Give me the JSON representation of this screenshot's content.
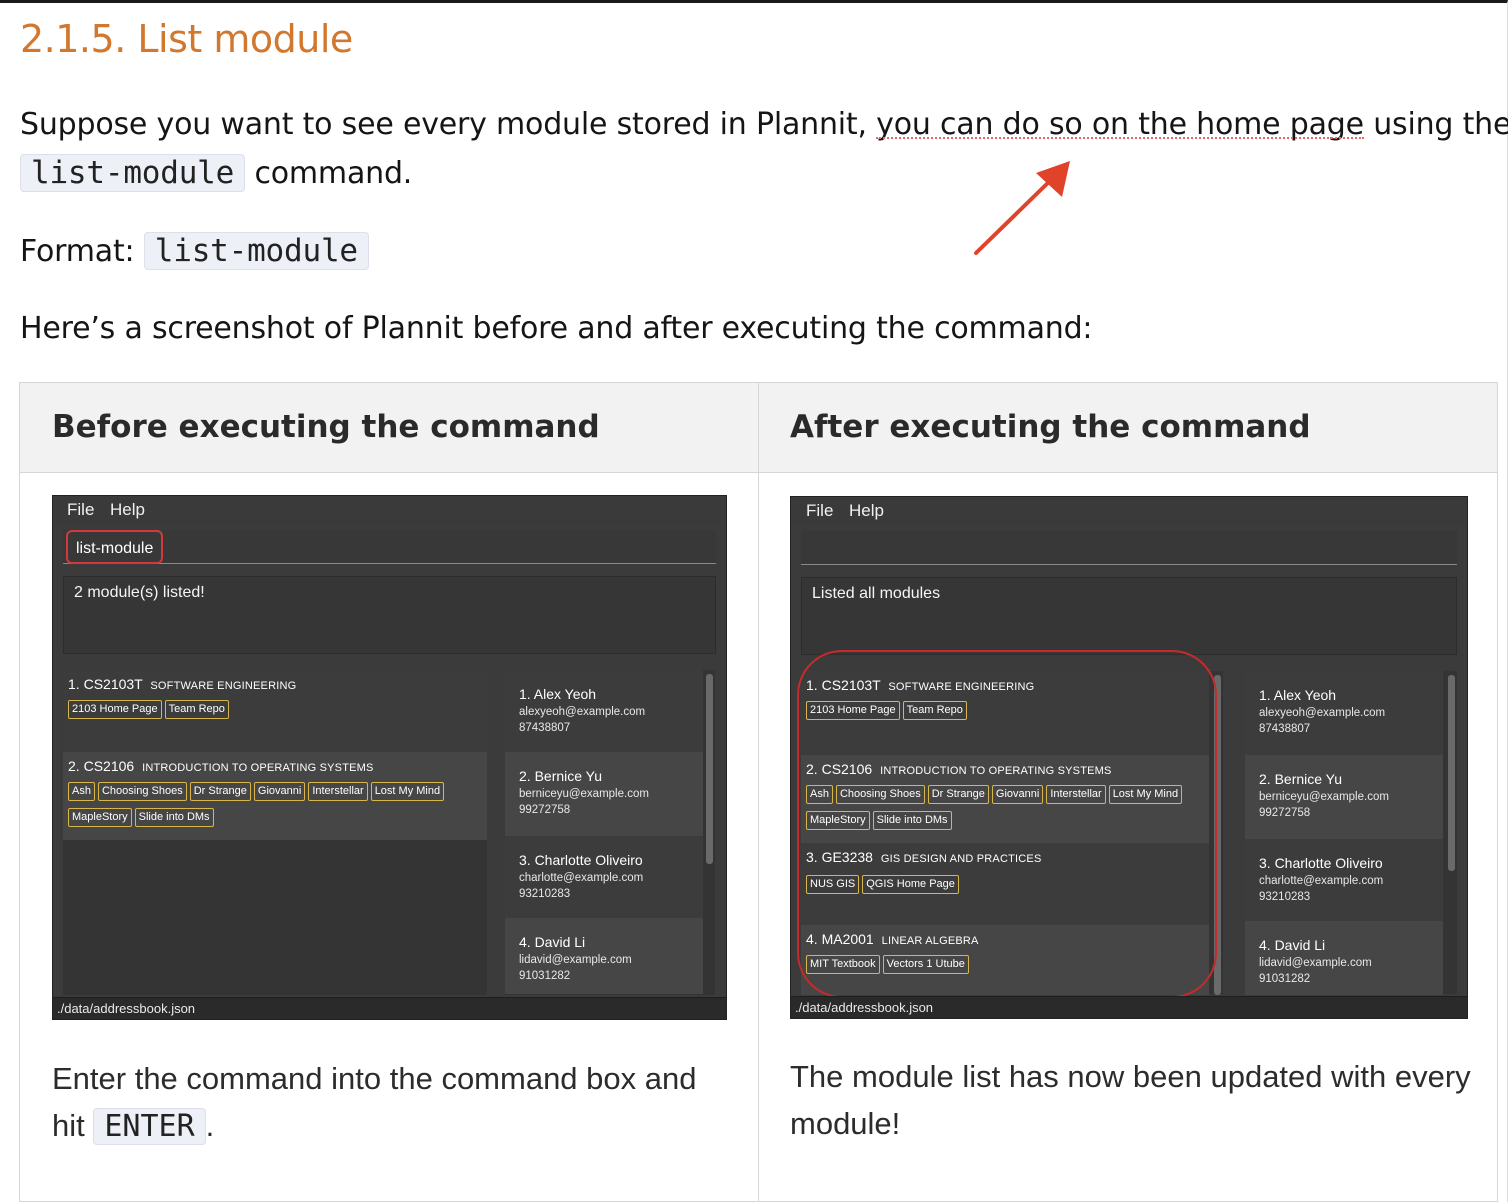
{
  "section_title": "2.1.5. List module",
  "para1": {
    "pre": "Suppose you want to see every module stored in Plannit, ",
    "highlight": "you can do so on the home page",
    "post": " using the",
    "code": "list-module",
    "tail": " command."
  },
  "format": {
    "label": "Format: ",
    "code": "list-module"
  },
  "para3": "Here’s a screenshot of Plannit before and after executing the command:",
  "table": {
    "before_header": "Before executing the command",
    "after_header": "After executing the command",
    "before_caption_pre": "Enter the command into the command box and hit ",
    "before_caption_code": "ENTER",
    "before_caption_post": ".",
    "after_caption": "The module list has now been updated with every module!"
  },
  "app": {
    "menu_file": "File",
    "menu_help": "Help",
    "status_path": "./data/addressbook.json",
    "before": {
      "command": "list-module",
      "result": "2 module(s) listed!",
      "modules": [
        {
          "index": "1.",
          "code": "CS2103T",
          "name": "SOFTWARE ENGINEERING",
          "tags_row1": [
            "2103 Home Page",
            "Team Repo"
          ],
          "tags_row2": []
        },
        {
          "index": "2.",
          "code": "CS2106",
          "name": "INTRODUCTION TO OPERATING SYSTEMS",
          "tags_row1": [
            "Ash",
            "Choosing Shoes",
            "Dr Strange",
            "Giovanni",
            "Interstellar",
            "Lost My Mind"
          ],
          "tags_row2": [
            "MapleStory",
            "Slide into DMs"
          ]
        }
      ]
    },
    "after": {
      "command": "",
      "result": "Listed all modules",
      "modules": [
        {
          "index": "1.",
          "code": "CS2103T",
          "name": "SOFTWARE ENGINEERING",
          "tags_row1": [
            "2103 Home Page",
            "Team Repo"
          ],
          "tags_row2": []
        },
        {
          "index": "2.",
          "code": "CS2106",
          "name": "INTRODUCTION TO OPERATING SYSTEMS",
          "tags_row1": [
            "Ash",
            "Choosing Shoes",
            "Dr Strange",
            "Giovanni",
            "Interstellar",
            "Lost My Mind"
          ],
          "tags_row2": [
            "MapleStory",
            "Slide into DMs"
          ]
        },
        {
          "index": "3.",
          "code": "GE3238",
          "name": "GIS DESIGN AND PRACTICES",
          "tags_row1": [
            "NUS GIS",
            "QGIS Home Page"
          ],
          "tags_row2": []
        },
        {
          "index": "4.",
          "code": "MA2001",
          "name": "LINEAR ALGEBRA",
          "tags_row1": [
            "MIT Textbook",
            "Vectors 1 Utube"
          ],
          "tags_row2": []
        }
      ]
    },
    "persons": [
      {
        "name": "1.  Alex Yeoh",
        "email": "alexyeoh@example.com",
        "phone": "87438807"
      },
      {
        "name": "2.  Bernice Yu",
        "email": "berniceyu@example.com",
        "phone": "99272758"
      },
      {
        "name": "3.  Charlotte Oliveiro",
        "email": "charlotte@example.com",
        "phone": "93210283"
      },
      {
        "name": "4.  David Li",
        "email": "lidavid@example.com",
        "phone": "91031282"
      }
    ]
  },
  "colors": {
    "title_accent": "#d2782e",
    "tag_border": "#d9b64a",
    "annotation_red": "#c42b2b",
    "app_bg": "#3b3b3b"
  }
}
